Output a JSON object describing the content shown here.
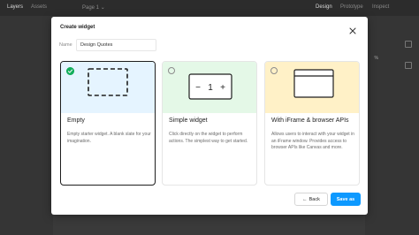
{
  "app": {
    "tabs_left": [
      "Layers",
      "Assets"
    ],
    "page_selector": "Page 1",
    "tabs_right": [
      "Design",
      "Prototype",
      "Inspect"
    ],
    "zoom_fragment": "%"
  },
  "modal": {
    "title": "Create widget",
    "name_label": "Name",
    "name_value": "Design Quotes",
    "cards": [
      {
        "title": "Empty",
        "description": "Empty starter widget. A blank slate for your imagination.",
        "selected": true,
        "hero_color": "#e5f4ff",
        "icon": "dashed-square-icon"
      },
      {
        "title": "Simple widget",
        "description": "Click directly on the widget to perform actions. The simplest way to get started.",
        "selected": false,
        "hero_color": "#e4f8e7",
        "icon": "counter-icon",
        "counter_minus": "−",
        "counter_value": "1",
        "counter_plus": "+"
      },
      {
        "title": "With iFrame & browser APIs",
        "description": "Allows users to interact with your widget in an iFrame window. Provides access to browser APIs like Canvas and more.",
        "selected": false,
        "hero_color": "#fff1c7",
        "icon": "browser-window-icon"
      }
    ],
    "back_label": "Back",
    "save_label": "Save as"
  },
  "colors": {
    "accent": "#0d99ff",
    "check": "#14ae5c"
  }
}
